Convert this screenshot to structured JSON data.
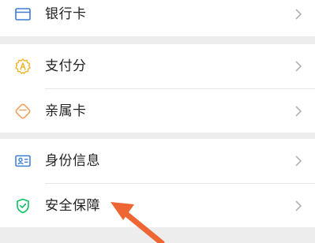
{
  "colors": {
    "accent": "#07c160",
    "gold": "#f0b429",
    "orange": "#f2a15a",
    "blue": "#3a7bd5",
    "annotation_arrow": "#ee6633"
  },
  "menu": {
    "items": [
      {
        "label": "银行卡",
        "icon": "card-icon"
      },
      {
        "label": "支付分",
        "icon": "credit-score-icon"
      },
      {
        "label": "亲属卡",
        "icon": "family-card-icon"
      },
      {
        "label": "身份信息",
        "icon": "id-card-icon"
      },
      {
        "label": "安全保障",
        "icon": "shield-icon"
      }
    ]
  }
}
